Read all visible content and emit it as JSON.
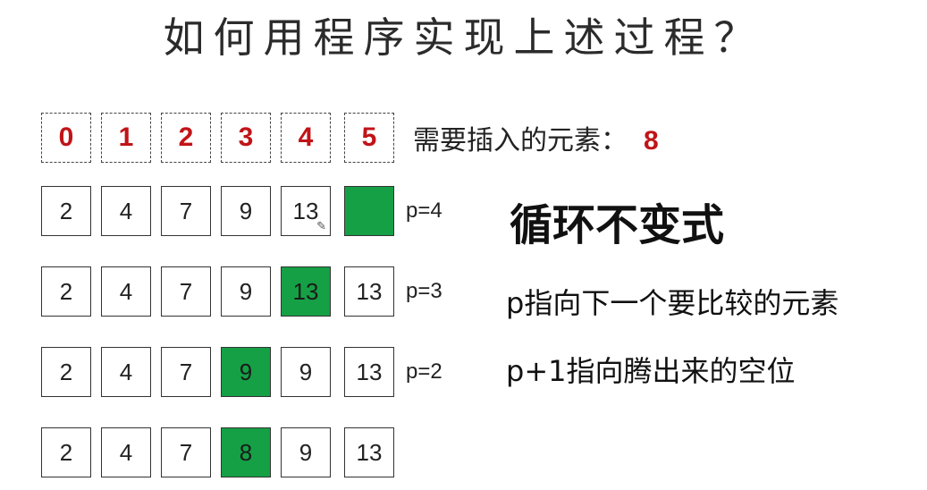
{
  "title": "如何用程序实现上述过程？",
  "index_row": [
    "0",
    "1",
    "2",
    "3",
    "4",
    "5"
  ],
  "insert_label": "需要插入的元素：",
  "insert_value": "8",
  "rows": [
    {
      "cells": [
        "2",
        "4",
        "7",
        "9",
        "13",
        ""
      ],
      "highlight": 5,
      "pencil_on": 4,
      "p_label": "p=4"
    },
    {
      "cells": [
        "2",
        "4",
        "7",
        "9",
        "13",
        "13"
      ],
      "highlight": 4,
      "p_label": "p=3"
    },
    {
      "cells": [
        "2",
        "4",
        "7",
        "9",
        "9",
        "13"
      ],
      "highlight": 3,
      "p_label": "p=2"
    },
    {
      "cells": [
        "2",
        "4",
        "7",
        "8",
        "9",
        "13"
      ],
      "highlight": 3,
      "p_label": ""
    }
  ],
  "heading": "循环不变式",
  "notes": [
    "p指向下一个要比较的元素",
    "p+1指向腾出来的空位"
  ],
  "colors": {
    "highlight": "#15a046",
    "index_text": "#c01418",
    "insert_value": "#c01418"
  }
}
